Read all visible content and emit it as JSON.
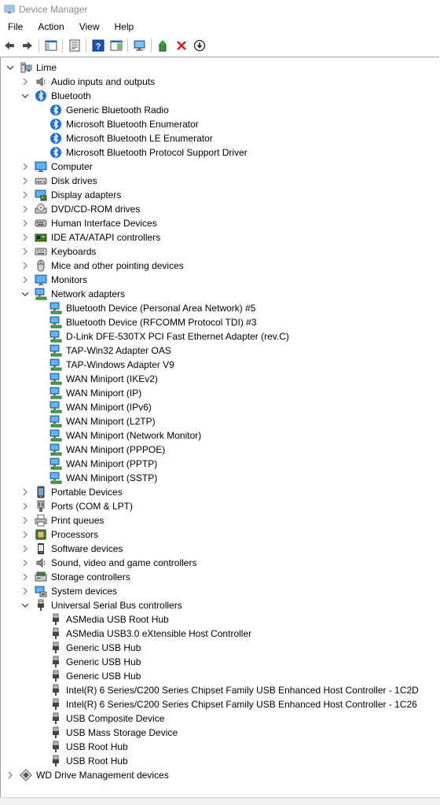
{
  "window": {
    "title": "Device Manager",
    "accent": "#0078d7"
  },
  "menu": [
    "File",
    "Action",
    "View",
    "Help"
  ],
  "toolbar": [
    {
      "icon": "back-arrow-icon",
      "enabled": true
    },
    {
      "icon": "forward-arrow-icon",
      "enabled": true
    },
    {
      "sep": true
    },
    {
      "icon": "show-hide-console-tree-icon",
      "enabled": true
    },
    {
      "sep": true
    },
    {
      "icon": "properties-icon",
      "enabled": true
    },
    {
      "sep": true
    },
    {
      "icon": "help-icon",
      "enabled": true
    },
    {
      "icon": "show-action-pane-icon",
      "enabled": true
    },
    {
      "sep": true
    },
    {
      "icon": "scan-hardware-changes-icon",
      "enabled": true
    },
    {
      "sep": true
    },
    {
      "icon": "update-driver-icon",
      "enabled": true
    },
    {
      "icon": "uninstall-device-icon",
      "enabled": true
    },
    {
      "icon": "disable-device-icon",
      "enabled": true
    }
  ],
  "tree": [
    {
      "label": "Lime",
      "level": 0,
      "icon": "computer-root-icon",
      "expanded": true
    },
    {
      "label": "Audio inputs and outputs",
      "level": 1,
      "icon": "speaker-icon",
      "expanded": false
    },
    {
      "label": "Bluetooth",
      "level": 1,
      "icon": "bluetooth-icon",
      "expanded": true
    },
    {
      "label": "Generic Bluetooth Radio",
      "level": 2,
      "icon": "bluetooth-icon"
    },
    {
      "label": "Microsoft Bluetooth Enumerator",
      "level": 2,
      "icon": "bluetooth-icon"
    },
    {
      "label": "Microsoft Bluetooth LE Enumerator",
      "level": 2,
      "icon": "bluetooth-icon"
    },
    {
      "label": "Microsoft Bluetooth Protocol Support Driver",
      "level": 2,
      "icon": "bluetooth-icon"
    },
    {
      "label": "Computer",
      "level": 1,
      "icon": "monitor-icon",
      "expanded": false
    },
    {
      "label": "Disk drives",
      "level": 1,
      "icon": "disk-drive-icon",
      "expanded": false
    },
    {
      "label": "Display adapters",
      "level": 1,
      "icon": "display-adapter-icon",
      "expanded": false
    },
    {
      "label": "DVD/CD-ROM drives",
      "level": 1,
      "icon": "dvd-drive-icon",
      "expanded": false
    },
    {
      "label": "Human Interface Devices",
      "level": 1,
      "icon": "hid-icon",
      "expanded": false
    },
    {
      "label": "IDE ATA/ATAPI controllers",
      "level": 1,
      "icon": "ide-controller-icon",
      "expanded": false
    },
    {
      "label": "Keyboards",
      "level": 1,
      "icon": "keyboard-icon",
      "expanded": false
    },
    {
      "label": "Mice and other pointing devices",
      "level": 1,
      "icon": "mouse-icon",
      "expanded": false
    },
    {
      "label": "Monitors",
      "level": 1,
      "icon": "monitor-icon",
      "expanded": false
    },
    {
      "label": "Network adapters",
      "level": 1,
      "icon": "network-adapter-icon",
      "expanded": true
    },
    {
      "label": "Bluetooth Device (Personal Area Network) #5",
      "level": 2,
      "icon": "network-adapter-icon"
    },
    {
      "label": "Bluetooth Device (RFCOMM Protocol TDI) #3",
      "level": 2,
      "icon": "network-adapter-icon"
    },
    {
      "label": "D-Link DFE-530TX PCI Fast Ethernet Adapter (rev.C)",
      "level": 2,
      "icon": "network-adapter-icon"
    },
    {
      "label": "TAP-Win32 Adapter OAS",
      "level": 2,
      "icon": "network-adapter-icon"
    },
    {
      "label": "TAP-Windows Adapter V9",
      "level": 2,
      "icon": "network-adapter-icon"
    },
    {
      "label": "WAN Miniport (IKEv2)",
      "level": 2,
      "icon": "network-adapter-icon"
    },
    {
      "label": "WAN Miniport (IP)",
      "level": 2,
      "icon": "network-adapter-icon"
    },
    {
      "label": "WAN Miniport (IPv6)",
      "level": 2,
      "icon": "network-adapter-icon"
    },
    {
      "label": "WAN Miniport (L2TP)",
      "level": 2,
      "icon": "network-adapter-icon"
    },
    {
      "label": "WAN Miniport (Network Monitor)",
      "level": 2,
      "icon": "network-adapter-icon"
    },
    {
      "label": "WAN Miniport (PPPOE)",
      "level": 2,
      "icon": "network-adapter-icon"
    },
    {
      "label": "WAN Miniport (PPTP)",
      "level": 2,
      "icon": "network-adapter-icon"
    },
    {
      "label": "WAN Miniport (SSTP)",
      "level": 2,
      "icon": "network-adapter-icon"
    },
    {
      "label": "Portable Devices",
      "level": 1,
      "icon": "portable-device-icon",
      "expanded": false
    },
    {
      "label": "Ports (COM & LPT)",
      "level": 1,
      "icon": "port-icon",
      "expanded": false
    },
    {
      "label": "Print queues",
      "level": 1,
      "icon": "printer-icon",
      "expanded": false
    },
    {
      "label": "Processors",
      "level": 1,
      "icon": "processor-icon",
      "expanded": false
    },
    {
      "label": "Software devices",
      "level": 1,
      "icon": "software-device-icon",
      "expanded": false
    },
    {
      "label": "Sound, video and game controllers",
      "level": 1,
      "icon": "speaker-icon",
      "expanded": false
    },
    {
      "label": "Storage controllers",
      "level": 1,
      "icon": "storage-controller-icon",
      "expanded": false
    },
    {
      "label": "System devices",
      "level": 1,
      "icon": "system-device-icon",
      "expanded": false
    },
    {
      "label": "Universal Serial Bus controllers",
      "level": 1,
      "icon": "usb-icon",
      "expanded": true
    },
    {
      "label": "ASMedia USB Root Hub",
      "level": 2,
      "icon": "usb-icon"
    },
    {
      "label": "ASMedia USB3.0 eXtensible Host Controller",
      "level": 2,
      "icon": "usb-icon"
    },
    {
      "label": "Generic USB Hub",
      "level": 2,
      "icon": "usb-icon"
    },
    {
      "label": "Generic USB Hub",
      "level": 2,
      "icon": "usb-icon"
    },
    {
      "label": "Generic USB Hub",
      "level": 2,
      "icon": "usb-icon"
    },
    {
      "label": "Intel(R) 6 Series/C200 Series Chipset Family USB Enhanced Host Controller - 1C2D",
      "level": 2,
      "icon": "usb-icon"
    },
    {
      "label": "Intel(R) 6 Series/C200 Series Chipset Family USB Enhanced Host Controller - 1C26",
      "level": 2,
      "icon": "usb-icon"
    },
    {
      "label": "USB Composite Device",
      "level": 2,
      "icon": "usb-icon"
    },
    {
      "label": "USB Mass Storage Device",
      "level": 2,
      "icon": "usb-icon"
    },
    {
      "label": "USB Root Hub",
      "level": 2,
      "icon": "usb-icon"
    },
    {
      "label": "USB Root Hub",
      "level": 2,
      "icon": "usb-icon"
    },
    {
      "label": "WD Drive Management devices",
      "level": 0,
      "icon": "wd-device-icon",
      "expanded": false
    }
  ]
}
